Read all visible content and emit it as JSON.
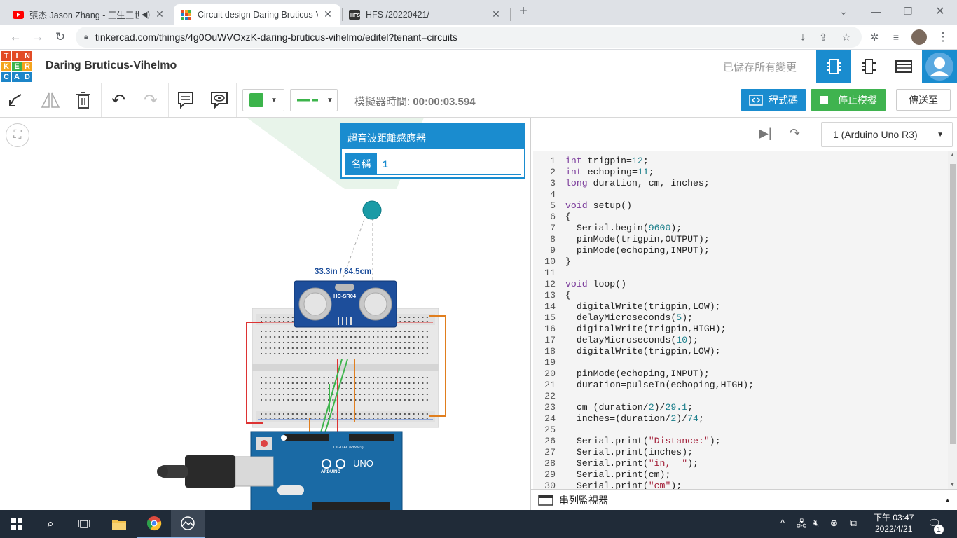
{
  "browser": {
    "tabs": [
      {
        "title": "張杰 Jason Zhang - 三生三世"
      },
      {
        "title": "Circuit design Daring Bruticus-V"
      },
      {
        "title": "HFS /20220421/"
      }
    ],
    "url": "tinkercad.com/things/4g0OuWVOxzK-daring-bruticus-vihelmo/editel?tenant=circuits"
  },
  "app": {
    "logo_letters": [
      "T",
      "I",
      "N",
      "K",
      "E",
      "R",
      "C",
      "A",
      "D"
    ],
    "project_title": "Daring Bruticus-Vihelmo",
    "save_status": "已儲存所有變更"
  },
  "toolbar": {
    "sim_time_label": "模擬器時間:",
    "sim_time_value": "00:00:03.594",
    "code_button": "程式碼",
    "stop_button": "停止模擬",
    "send_button": "傳送至",
    "fill_color": "#3cb44b",
    "wire_color": "#3cb44b"
  },
  "inspector": {
    "title": "超音波距離感應器",
    "name_label": "名稱",
    "name_value": "1"
  },
  "circuit": {
    "distance_readout": "33.3in / 84.5cm",
    "sensor_label": "HC-SR04",
    "board_label": "UNO",
    "board_brand": "ARDUINO",
    "digital_label": "DIGITAL (PWM~)"
  },
  "code_panel": {
    "device_select": "1 (Arduino Uno R3)",
    "serial_monitor": "串列監視器",
    "lines": [
      "int trigpin=12;",
      "int echoping=11;",
      "long duration, cm, inches;",
      "",
      "void setup()",
      "{",
      "  Serial.begin(9600);",
      "  pinMode(trigpin,OUTPUT);",
      "  pinMode(echoping,INPUT);",
      "}",
      "",
      "void loop()",
      "{",
      "  digitalWrite(trigpin,LOW);",
      "  delayMicroseconds(5);",
      "  digitalWrite(trigpin,HIGH);",
      "  delayMicroseconds(10);",
      "  digitalWrite(trigpin,LOW);",
      "",
      "  pinMode(echoping,INPUT);",
      "  duration=pulseIn(echoping,HIGH);",
      "",
      "  cm=(duration/2)/29.1;",
      "  inches=(duration/2)/74;",
      "",
      "  Serial.print(\"Distance:\");",
      "  Serial.print(inches);",
      "  Serial.print(\"in,  \");",
      "  Serial.print(cm);",
      "  Serial.print(\"cm\");"
    ]
  },
  "taskbar": {
    "time": "下午 03:47",
    "date": "2022/4/21",
    "notification_count": "1"
  },
  "colors": {
    "accent": "#1a8ccf",
    "stop_green": "#3fb34f",
    "tab_bg": "#dee1e6"
  }
}
